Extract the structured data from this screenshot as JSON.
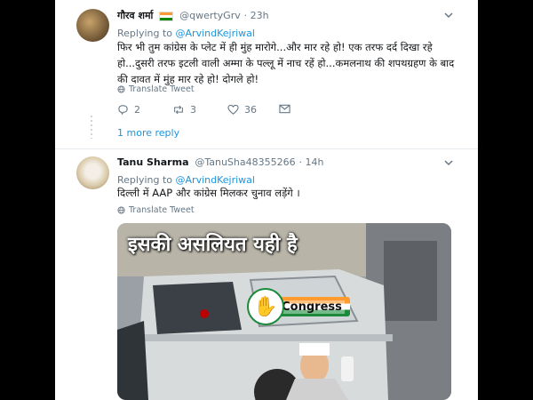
{
  "tweets": [
    {
      "name": "गौरव शर्मा",
      "handle": "@qwertyGrv",
      "time": "23h",
      "replying_to_prefix": "Replying to",
      "replying_to": "@ArvindKejriwal",
      "text": "फिर भी तुम कांग्रेस के प्लेट में ही मुंह मारोगे...और मार रहे हो! एक तरफ दर्द दिखा रहे हो...दुसरी तरफ इटली वाली अम्मा के पल्लू में नाच रहें हो...कमलनाथ की शपथग्रहण के बाद की दावत में मुंह मार रहे हो! दोगले हो!",
      "translate": "Translate Tweet",
      "replies": "2",
      "retweets": "3",
      "likes": "36"
    },
    {
      "name": "Tanu Sharma",
      "handle": "@TanuSha48355266",
      "time": "14h",
      "replying_to_prefix": "Replying to",
      "replying_to": "@ArvindKejriwal",
      "text": "दिल्ली में AAP और कांग्रेस मिलकर चुनाव लड़ेंगे ।",
      "translate": "Translate Tweet",
      "media_caption": "इसकी असलियत यही है",
      "media_logo_text": "Congress"
    }
  ],
  "more_replies": "1 more reply",
  "colors": {
    "link": "#1b95e0",
    "muted": "#657786",
    "divider": "#e6ecf0"
  }
}
